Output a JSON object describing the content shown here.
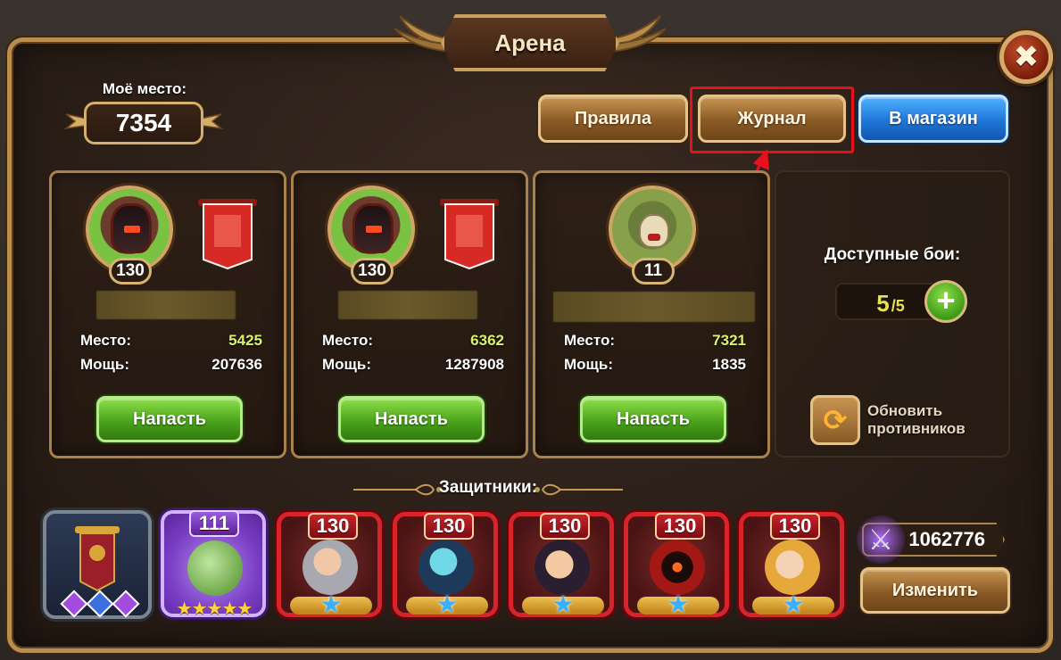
{
  "title": "Арена",
  "my_place": {
    "label": "Моё место:",
    "value": "7354"
  },
  "buttons": {
    "rules": "Правила",
    "journal": "Журнал",
    "shop": "В магазин"
  },
  "opponents": [
    {
      "level": "130",
      "rank_label": "Место:",
      "rank": "5425",
      "power_label": "Мощь:",
      "power": "207636",
      "attack": "Напасть",
      "avatar": "dark-knight"
    },
    {
      "level": "130",
      "rank_label": "Место:",
      "rank": "6362",
      "power_label": "Мощь:",
      "power": "1287908",
      "attack": "Напасть",
      "avatar": "dark-knight"
    },
    {
      "level": "11",
      "rank_label": "Место:",
      "rank": "7321",
      "power_label": "Мощь:",
      "power": "1835",
      "attack": "Напасть",
      "avatar": "skeleton"
    }
  ],
  "battles": {
    "label": "Доступные бои:",
    "current": "5",
    "max": "/5"
  },
  "refresh": {
    "label": "Обновить противников"
  },
  "defenders": {
    "title": "Защитники:",
    "pet_level": "111",
    "pet_stars": "★★★★★",
    "heroes": [
      {
        "level": "130",
        "star": "★"
      },
      {
        "level": "130",
        "star": "★"
      },
      {
        "level": "130",
        "star": "★"
      },
      {
        "level": "130",
        "star": "★"
      },
      {
        "level": "130",
        "star": "★"
      }
    ],
    "team_power": "1062776",
    "change": "Изменить"
  },
  "colors": {
    "rank": "#d9f26b",
    "highlight": "#e8101b",
    "accent_gold": "#c9a062"
  }
}
